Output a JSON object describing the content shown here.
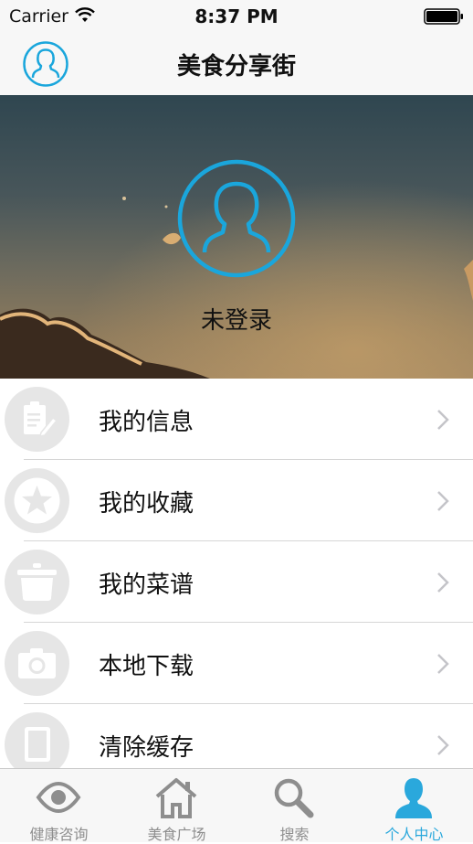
{
  "status_bar": {
    "carrier": "Carrier",
    "time": "8:37 PM"
  },
  "nav": {
    "title": "美食分享街",
    "avatar_icon": "user-avatar-icon"
  },
  "profile": {
    "login_status": "未登录",
    "avatar_icon": "user-avatar-icon",
    "accent_color": "#1aa6dc"
  },
  "menu": {
    "items": [
      {
        "label": "我的信息",
        "icon": "clipboard-pencil-icon"
      },
      {
        "label": "我的收藏",
        "icon": "star-icon"
      },
      {
        "label": "我的菜谱",
        "icon": "pot-icon"
      },
      {
        "label": "本地下载",
        "icon": "camera-icon"
      },
      {
        "label": "清除缓存",
        "icon": "notebook-icon"
      }
    ]
  },
  "tabs": [
    {
      "label": "健康咨询",
      "icon": "eye-icon",
      "active": false
    },
    {
      "label": "美食广场",
      "icon": "home-icon",
      "active": false
    },
    {
      "label": "搜索",
      "icon": "search-icon",
      "active": false
    },
    {
      "label": "个人中心",
      "icon": "person-icon",
      "active": true
    }
  ],
  "colors": {
    "accent": "#1aa6dc",
    "tab_active": "#2aa8dc",
    "tab_inactive": "#8e8e8e",
    "icon_bg": "#e6e6e6"
  }
}
